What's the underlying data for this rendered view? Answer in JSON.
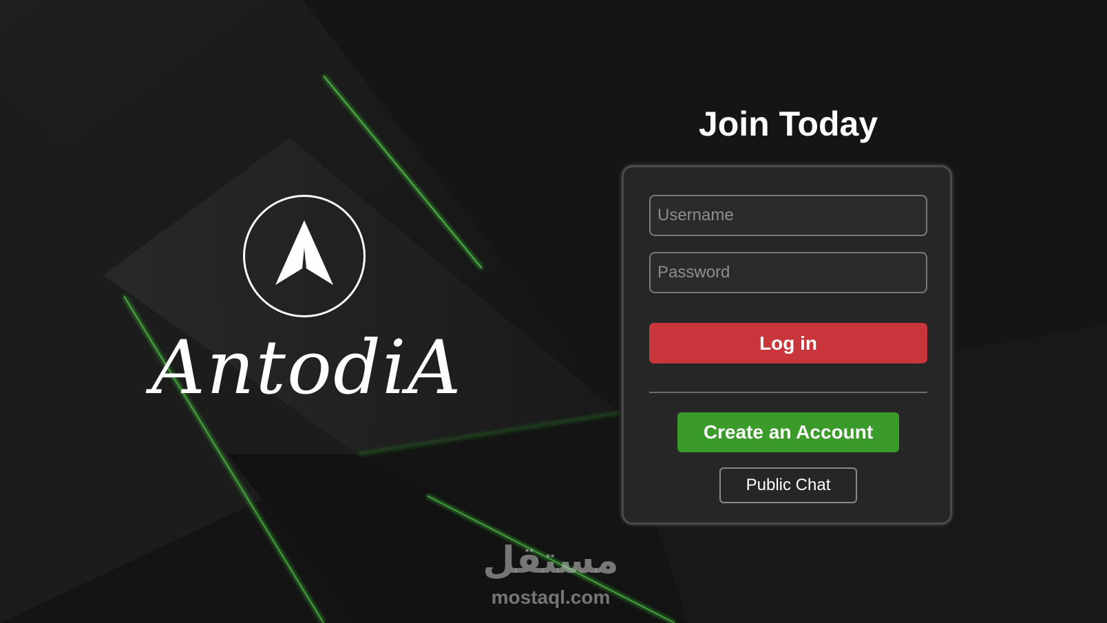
{
  "brand": {
    "name": "AntodiA",
    "logo_icon": "arrowhead-icon"
  },
  "login_form": {
    "title": "Join Today",
    "username_placeholder": "Username",
    "username_value": "",
    "password_placeholder": "Password",
    "password_value": "",
    "login_label": "Log in",
    "create_account_label": "Create an Account",
    "public_chat_label": "Public Chat"
  },
  "watermark": {
    "arabic": "مستقل",
    "latin": "mostaql.com"
  },
  "colors": {
    "background": "#161616",
    "accent_green": "#3a9a2a",
    "login_red": "#c8353a",
    "card": "#262626"
  }
}
